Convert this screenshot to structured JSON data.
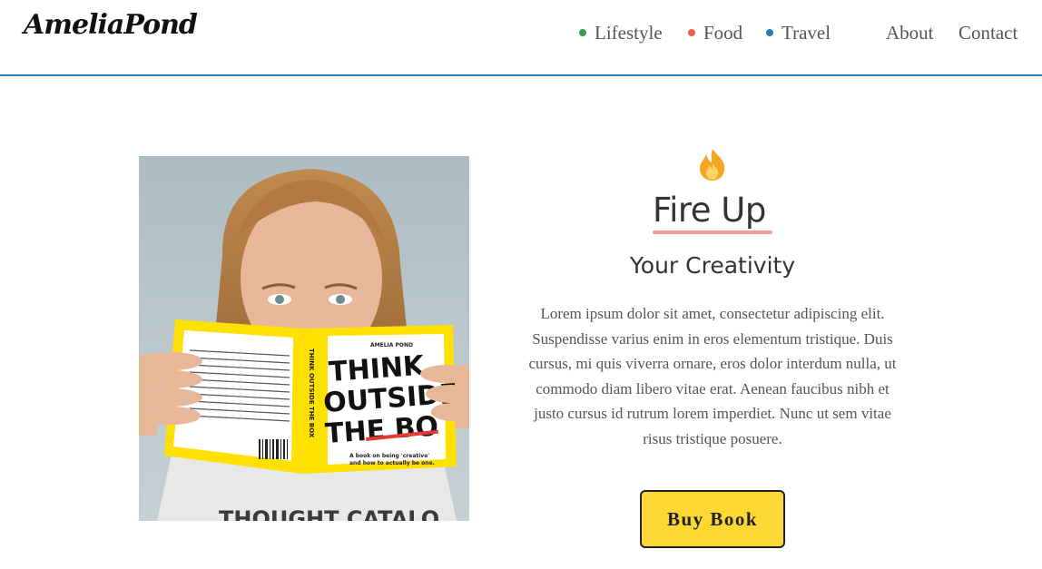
{
  "header": {
    "logo_main": "Amelia",
    "logo_second": "Pond",
    "nav": [
      {
        "label": "Lifestyle",
        "dot_color": "#3a9a4a"
      },
      {
        "label": "Food",
        "dot_color": "#e8604a"
      },
      {
        "label": "Travel",
        "dot_color": "#2a7ab8"
      },
      {
        "label": "About"
      },
      {
        "label": "Contact"
      }
    ],
    "border_color": "#2a7ab8"
  },
  "hero": {
    "image": {
      "book_author": "AMELIA POND",
      "book_title_lines": [
        "THINK",
        "OUTSIDE",
        "THE BO"
      ],
      "book_spine": "THINK OUTSIDE THE BOX",
      "book_tagline_lines": [
        "A book on being 'creative'",
        "and how to actually be one."
      ],
      "shirt_text": "THOUGHT CATALO"
    },
    "icon": "fire-icon",
    "headline": "Fire Up",
    "headline_underline_color": "#ef9e96",
    "subheadline": "Your Creativity",
    "body_lines": [
      "Lorem ipsum dolor sit amet, consectetur adipiscing elit.",
      "Suspendisse varius enim in eros elementum tristique. Duis",
      "cursus, mi quis viverra ornare, eros dolor interdum nulla, ut",
      "commodo diam libero vitae erat. Aenean faucibus nibh et",
      "justo cursus id rutrum lorem imperdiet. Nunc ut sem vitae",
      "risus tristique posuere."
    ],
    "cta_label": "Buy Book",
    "cta_color": "#fdd835"
  }
}
